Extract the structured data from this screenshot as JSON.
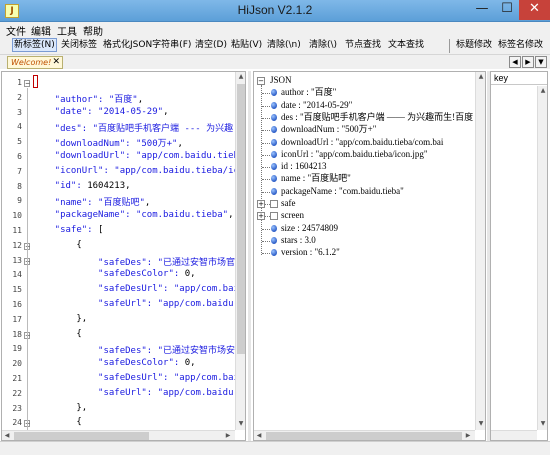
{
  "window": {
    "title": "HiJson V2.1.2",
    "icon_glyph": "J",
    "controls": {
      "minimize": "—",
      "maximize": "☐",
      "close": "✕"
    },
    "close_color": "#c7423a"
  },
  "menu": [
    "文件",
    "编辑",
    "工具",
    "帮助"
  ],
  "toolbar": [
    "新标签(N)",
    "关闭标签",
    "格式化JSON字符串(F)",
    "清空(D)",
    "粘贴(V)",
    "清除(\\n)",
    "清除(\\)",
    "节点查找",
    "文本查找",
    "标题修改",
    "标签名修改"
  ],
  "tab": {
    "label": "Welcome!",
    "close": "✕"
  },
  "tab_nav": {
    "left": "◀",
    "right": "▶",
    "dropdown": "▼"
  },
  "editor": {
    "line_numbers": [
      "1",
      "2",
      "3",
      "4",
      "5",
      "6",
      "7",
      "8",
      "9",
      "10",
      "11",
      "12",
      "13",
      "14",
      "15",
      "16",
      "17",
      "18",
      "19",
      "20",
      "21",
      "22",
      "23",
      "24"
    ],
    "fold_markers": {
      "1": "−",
      "12": "−",
      "13": "−",
      "18": "−",
      "24": "−"
    },
    "lines": [
      [
        {
          "t": "{",
          "c": "n"
        }
      ],
      [
        {
          "t": "    \"author\": ",
          "c": "k"
        },
        {
          "t": "\"百度\"",
          "c": "s"
        },
        {
          "t": ",",
          "c": "n"
        }
      ],
      [
        {
          "t": "    \"date\": ",
          "c": "k"
        },
        {
          "t": "\"2014-05-29\"",
          "c": "s"
        },
        {
          "t": ",",
          "c": "n"
        }
      ],
      [
        {
          "t": "    \"des\": ",
          "c": "k"
        },
        {
          "t": "\"百度贴吧手机客户端 --- 为兴趣",
          "c": "s"
        }
      ],
      [
        {
          "t": "    \"downloadNum\": ",
          "c": "k"
        },
        {
          "t": "\"500万+\"",
          "c": "s"
        },
        {
          "t": ",",
          "c": "n"
        }
      ],
      [
        {
          "t": "    \"downloadUrl\": ",
          "c": "k"
        },
        {
          "t": "\"app/com.baidu.tieba",
          "c": "s"
        }
      ],
      [
        {
          "t": "    \"iconUrl\": ",
          "c": "k"
        },
        {
          "t": "\"app/com.baidu.tieba/ico",
          "c": "s"
        }
      ],
      [
        {
          "t": "    \"id\": ",
          "c": "k"
        },
        {
          "t": "1604213",
          "c": "n"
        },
        {
          "t": ",",
          "c": "n"
        }
      ],
      [
        {
          "t": "    \"name\": ",
          "c": "k"
        },
        {
          "t": "\"百度贴吧\"",
          "c": "s"
        },
        {
          "t": ",",
          "c": "n"
        }
      ],
      [
        {
          "t": "    \"packageName\": ",
          "c": "k"
        },
        {
          "t": "\"com.baidu.tieba\"",
          "c": "s"
        },
        {
          "t": ",",
          "c": "n"
        }
      ],
      [
        {
          "t": "    \"safe\": ",
          "c": "k"
        },
        {
          "t": "[",
          "c": "n"
        }
      ],
      [
        {
          "t": "        {",
          "c": "n"
        }
      ],
      [
        {
          "t": "            \"safeDes\": ",
          "c": "k"
        },
        {
          "t": "\"已通过安智市场官",
          "c": "s"
        }
      ],
      [
        {
          "t": "            \"safeDesColor\": ",
          "c": "k"
        },
        {
          "t": "0",
          "c": "n"
        },
        {
          "t": ",",
          "c": "n"
        }
      ],
      [
        {
          "t": "            \"safeDesUrl\": ",
          "c": "k"
        },
        {
          "t": "\"app/com.baid",
          "c": "s"
        }
      ],
      [
        {
          "t": "            \"safeUrl\": ",
          "c": "k"
        },
        {
          "t": "\"app/com.baidu.t",
          "c": "s"
        }
      ],
      [
        {
          "t": "        },",
          "c": "n"
        }
      ],
      [
        {
          "t": "        {",
          "c": "n"
        }
      ],
      [
        {
          "t": "            \"safeDes\": ",
          "c": "k"
        },
        {
          "t": "\"已通过安智市场安",
          "c": "s"
        }
      ],
      [
        {
          "t": "            \"safeDesColor\": ",
          "c": "k"
        },
        {
          "t": "0",
          "c": "n"
        },
        {
          "t": ",",
          "c": "n"
        }
      ],
      [
        {
          "t": "            \"safeDesUrl\": ",
          "c": "k"
        },
        {
          "t": "\"app/com.baid",
          "c": "s"
        }
      ],
      [
        {
          "t": "            \"safeUrl\": ",
          "c": "k"
        },
        {
          "t": "\"app/com.baidu.t",
          "c": "s"
        }
      ],
      [
        {
          "t": "        },",
          "c": "n"
        }
      ],
      [
        {
          "t": "        {",
          "c": "n"
        }
      ]
    ]
  },
  "tree": {
    "root": "JSON",
    "nodes": [
      {
        "kind": "leaf",
        "text": "author : \"百度\""
      },
      {
        "kind": "leaf",
        "text": "date : \"2014-05-29\""
      },
      {
        "kind": "leaf",
        "text": "des : \"百度贴吧手机客户端 —— 为兴趣而生!百度"
      },
      {
        "kind": "leaf",
        "text": "downloadNum : \"500万+\""
      },
      {
        "kind": "leaf",
        "text": "downloadUrl : \"app/com.baidu.tieba/com.bai"
      },
      {
        "kind": "leaf",
        "text": "iconUrl : \"app/com.baidu.tieba/icon.jpg\""
      },
      {
        "kind": "leaf",
        "text": "id : 1604213"
      },
      {
        "kind": "leaf",
        "text": "name : \"百度贴吧\""
      },
      {
        "kind": "leaf",
        "text": "packageName : \"com.baidu.tieba\""
      },
      {
        "kind": "branch",
        "text": "safe"
      },
      {
        "kind": "branch",
        "text": "screen"
      },
      {
        "kind": "leaf",
        "text": "size : 24574809"
      },
      {
        "kind": "leaf",
        "text": "stars : 3.0"
      },
      {
        "kind": "leaf",
        "text": "version : \"6.1.2\""
      }
    ],
    "expand_glyph": "+",
    "collapse_glyph": "−"
  },
  "detail": {
    "column_header": "key"
  },
  "colors": {
    "key": "#1a1ae0",
    "titlebar": "#6aa8de"
  }
}
